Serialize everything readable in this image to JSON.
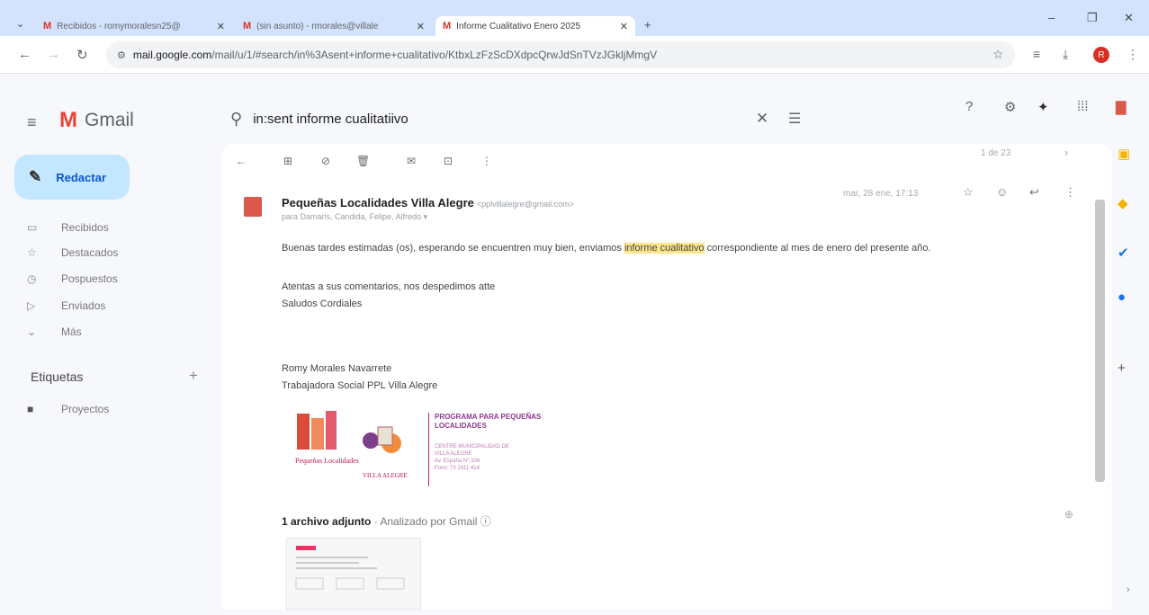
{
  "browser": {
    "tabs": [
      {
        "label": "Recibidos - romymoralesn25@",
        "active": false
      },
      {
        "label": "(sin asunto) - rmorales@villale",
        "active": false
      },
      {
        "label": "Informe Cualitativo Enero 2025",
        "active": true
      }
    ],
    "new_tab": "+",
    "url_host": "mail.google.com",
    "url_path": "/mail/u/1/#search/in%3Asent+informe+cualitativo/KtbxLzFzScDXdpcQrwJdSnTVzJGkljMmgV",
    "avatar_letter": "R"
  },
  "app": {
    "name": "Gmail",
    "search_query": "in:sent informe cualitatiivo"
  },
  "sidebar": {
    "compose_label": "Redactar",
    "items": [
      {
        "label": "Recibidos",
        "icon": "inbox-icon"
      },
      {
        "label": "Destacados",
        "icon": "star-icon"
      },
      {
        "label": "Pospuestos",
        "icon": "clock-icon"
      },
      {
        "label": "Enviados",
        "icon": "send-icon"
      },
      {
        "label": "Más",
        "icon": "chevron-down-icon"
      }
    ],
    "labels_heading": "Etiquetas",
    "labels": [
      {
        "label": "Proyectos",
        "icon": "label-icon"
      }
    ]
  },
  "toolbar": {
    "pagination": "1 de 23"
  },
  "message": {
    "sender_name": "Pequeñas Localidades Villa Alegre",
    "sender_email": "<pplvillalegre@gmail.com>",
    "recipients": "para Damaris, Candida, Felipe, Alfredo",
    "date": "mar, 28 ene, 17:13",
    "body_pre": "Buenas tardes estimadas (os), esperando se encuentren muy bien, enviamos ",
    "body_highlight": "informe cualitativo",
    "body_post": " correspondiente al mes de enero del presente año.",
    "line2": "Atentas a sus comentarios, nos despedimos atte",
    "line3": "Saludos Cordiales",
    "sig_name": "Romy Morales Navarrete",
    "sig_title": "Trabajadora Social PPL Villa Alegre",
    "sig_logo_text": "Pequeñas Localidades",
    "sig_logo_place": "VILLA ALEGRE",
    "sig_program": "PROGRAMA PARA PEQUEÑAS LOCALIDADES",
    "sig_sub1": "CENTRE MUNICIPALIDAD DE",
    "sig_sub2": "VILLA ALEGRE",
    "sig_sub3": "Av. España N° 106",
    "sig_sub4": "Fono: 73 2411 414",
    "attachments_label": "1 archivo adjunto",
    "attachments_scan": " · Analizado por Gmail"
  },
  "colors": {
    "accent": "#0b57d0",
    "compose": "#c2e7ff",
    "highlight": "#fde68a",
    "brand": "#ea4335"
  }
}
